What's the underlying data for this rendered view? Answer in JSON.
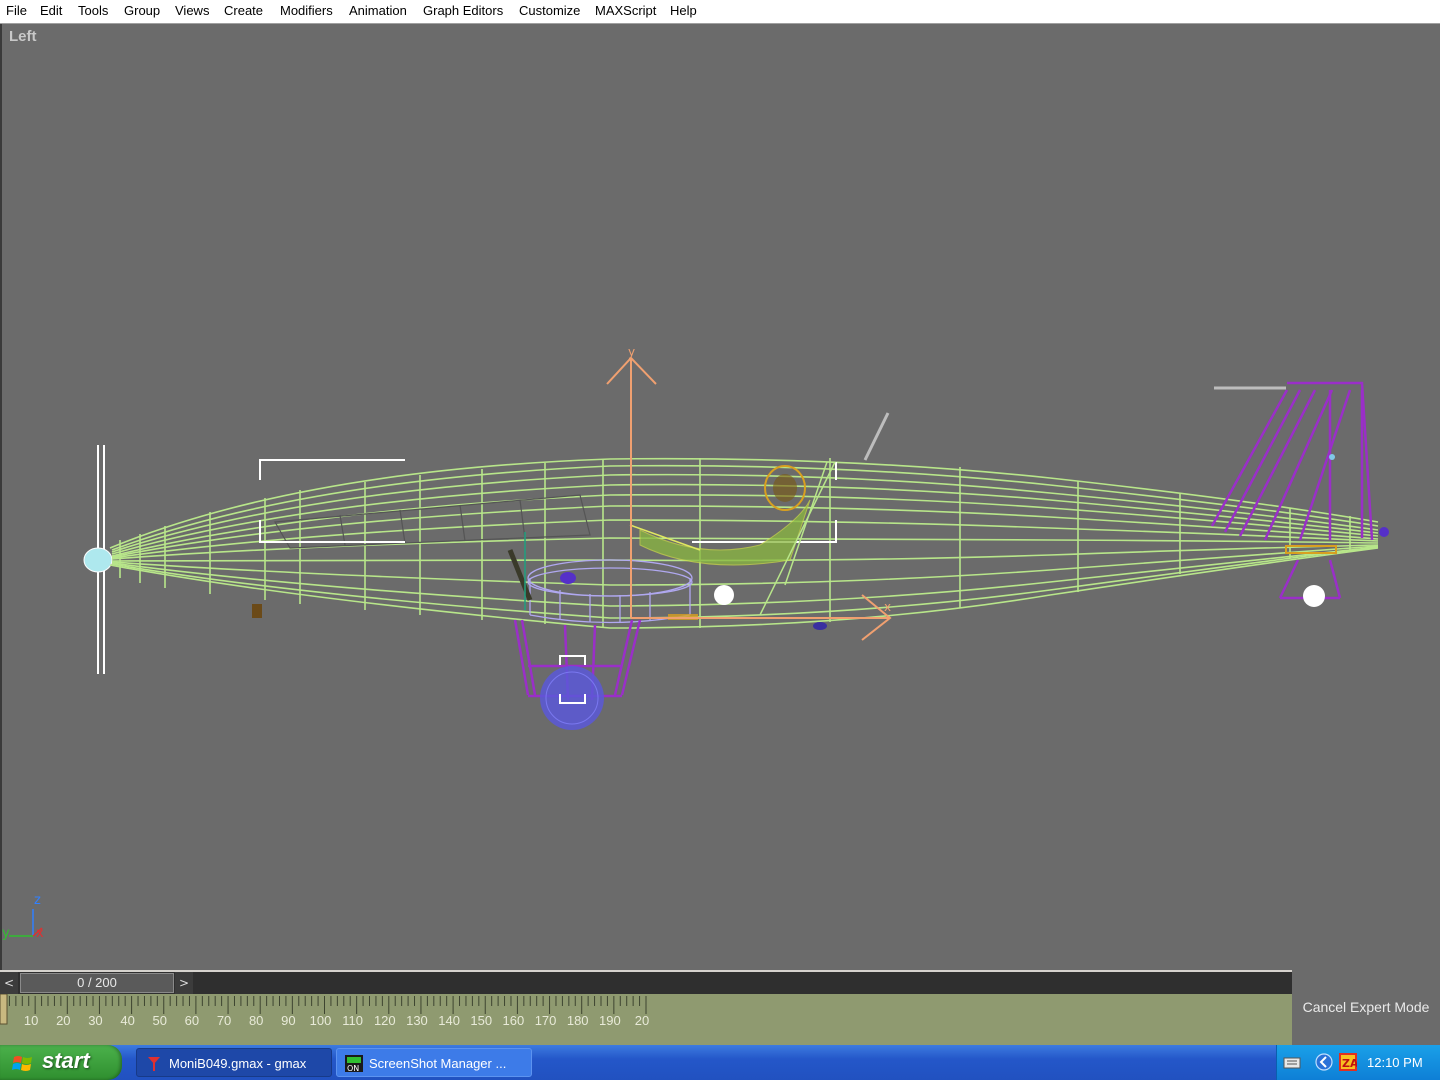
{
  "menubar": {
    "items": [
      "File",
      "Edit",
      "Tools",
      "Group",
      "Views",
      "Create",
      "Modifiers",
      "Animation",
      "Graph Editors",
      "Customize",
      "MAXScript",
      "Help"
    ]
  },
  "viewport": {
    "label": "Left",
    "axis_labels": {
      "z": "z",
      "y": "y",
      "x": "x"
    },
    "gizmo_labels": {
      "y": "y",
      "x": "x"
    }
  },
  "timeline": {
    "frame_display": "0 / 200",
    "prev_arrow": "<",
    "next_arrow": ">",
    "ticks": [
      "10",
      "20",
      "30",
      "40",
      "50",
      "60",
      "70",
      "80",
      "90",
      "100",
      "110",
      "120",
      "130",
      "140",
      "150",
      "160",
      "170",
      "180",
      "190",
      "20"
    ]
  },
  "expert_mode": {
    "label": "Cancel Expert Mode"
  },
  "taskbar": {
    "start_label": "start",
    "tasks": [
      {
        "label": "MoniB049.gmax - gmax",
        "icon": "gmax-icon",
        "active": true
      },
      {
        "label": "ScreenShot Manager ...",
        "icon": "screenshot-manager-icon",
        "active": false
      }
    ],
    "clock": "12:10 PM",
    "tray_icons": [
      "keyboard-icon",
      "chevron-left-icon",
      "zonealarm-icon"
    ]
  },
  "colors": {
    "viewport_bg": "#6b6b6b",
    "fuselage": "#b8e68a",
    "tail": "#9a2fc8",
    "gizmo": "#f0a070",
    "wheel": "#5a58d8",
    "pilot": "#d8a020",
    "timeline_track": "#8f9a70"
  }
}
